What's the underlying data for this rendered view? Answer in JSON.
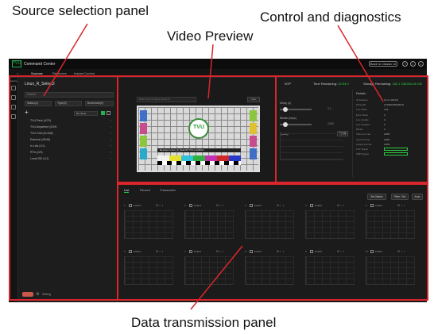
{
  "callouts": {
    "source_panel": "Source selection panel",
    "control_panel": "Control and diagnostics",
    "video_preview": "Video Preview",
    "data_panel": "Data transmission panel"
  },
  "colors": {
    "annotation_red": "#d9262c",
    "accent_green": "#2ecc40"
  },
  "app": {
    "logo": "TVU",
    "title": "Command Center",
    "back_button": "Back to Classic UI",
    "tabs": [
      "Sources",
      "Receivers",
      "Instant Control"
    ]
  },
  "rail": {
    "label": "Source"
  },
  "source": {
    "name": "Linux_R_Select2",
    "search_placeholder": "Search",
    "filters": [
      "Status(1)",
      "Type(2)",
      "Bookmark(3)"
    ],
    "add": "+",
    "sort": "By Name",
    "list": [
      {
        "label": "TVU Pack (4/70)"
      },
      {
        "label": "TVU Anywhere (0/29)"
      },
      {
        "label": "TVU Grid (21/168)"
      },
      {
        "label": "External (45/45)"
      },
      {
        "label": "In Link (1/1)"
      },
      {
        "label": "RTIL (0/0)"
      },
      {
        "label": "Local SDI (1/1)"
      }
    ],
    "footer": "Setting"
  },
  "video": {
    "input_placeholder": "Enter Source Name (Search)",
    "button": "Take",
    "logo_text": "TVU",
    "band_text": "Receiver Linux_R_Select2 TVU-LAUNCH"
  },
  "control": {
    "ntp": "NTP",
    "time_label": "Time Remaining:",
    "time_value": "02:53:0",
    "storage_label": "Storage Remaining:",
    "storage_value": "163.1 GB/304.08 GB",
    "delay_label": "Delay (s)",
    "delay_value": "2.1",
    "bitrate_label": "Bitrate (kbps)",
    "bitrate_value": "1000",
    "quality_label": "Quality",
    "apply": "Apply",
    "details_title": "Details",
    "details": [
      {
        "k": "IP Address",
        "v": "10.12.169.80"
      },
      {
        "k": "R PeerID",
        "v": "1234567890ABCD"
      },
      {
        "k": "Live Mode",
        "v": "LVE"
      },
      {
        "k": "Error Mode",
        "v": "0"
      },
      {
        "k": "Live Quality",
        "v": "0"
      },
      {
        "k": "Live Quality2",
        "v": "0"
      },
      {
        "k": "Bitrate",
        "v": "0"
      },
      {
        "k": "Video Format",
        "v": "1080i"
      },
      {
        "k": "Input Format",
        "v": "1080i"
      },
      {
        "k": "Output Format",
        "v": "1080i"
      },
      {
        "k": "FTP Signal",
        "v": ""
      },
      {
        "k": "SMP Signal",
        "v": ""
      }
    ]
  },
  "data": {
    "tabs": [
      "List",
      "Record",
      "Transcoder"
    ],
    "buttons": [
      "Set Matrix",
      "Filter: Set",
      "Auto"
    ],
    "modules": [
      {
        "num": "1",
        "name": "LiveLd"
      },
      {
        "num": "2",
        "name": "LiveLd"
      },
      {
        "num": "3",
        "name": "LiveLd"
      },
      {
        "num": "4",
        "name": "LiveLd"
      },
      {
        "num": "5",
        "name": "LiveLd"
      },
      {
        "num": "6",
        "name": "LiveLd"
      },
      {
        "num": "7",
        "name": "LiveLd"
      },
      {
        "num": "8",
        "name": "LiveLd"
      },
      {
        "num": "9",
        "name": "LiveLd"
      },
      {
        "num": "10",
        "name": "LiveLd"
      }
    ]
  }
}
